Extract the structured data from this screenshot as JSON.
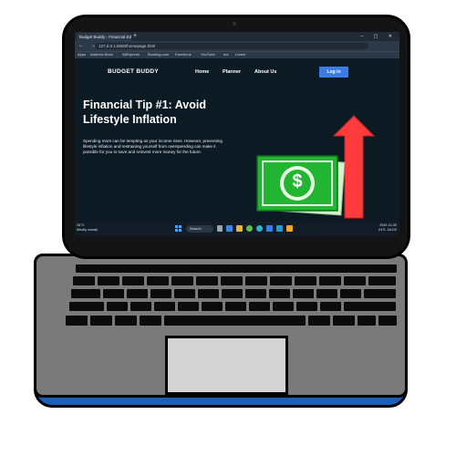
{
  "browser": {
    "tab_title": "Budget Buddy - Financial Educa...",
    "tab_new": "+",
    "window_controls": "– ▢ ✕",
    "nav_icons": "← → ⟳",
    "url": "127.0.0.1:5500/homepage.html",
    "bookmarks": [
      {
        "label": "Apps",
        "icon": "apps-icon"
      },
      {
        "label": "Address Book",
        "icon": "bookmark-icon"
      },
      {
        "label": "AliExpress",
        "icon": "bookmark-icon"
      },
      {
        "label": "Booking.com",
        "icon": "bookmark-icon"
      },
      {
        "label": "Facebook",
        "icon": "bookmark-icon"
      },
      {
        "label": "YouTube",
        "icon": "youtube-icon"
      },
      {
        "label": "eur",
        "icon": "bookmark-icon"
      },
      {
        "label": "Lorem",
        "icon": "folder-icon"
      }
    ]
  },
  "site": {
    "brand": "BUDGET BUDDY",
    "nav": [
      "Home",
      "Planner",
      "About Us"
    ],
    "login": "Log in",
    "headline": "Financial Tip #1: Avoid Lifestyle Inflation",
    "paragraph": "Spending more can be tempting as your income rises. However, preventing lifestyle inflation and restraining yourself from overspending can make it possible for you to save and reinvest more money for the future.",
    "hero_image": "money-arrow-up-icon",
    "currency_symbol": "$"
  },
  "taskbar": {
    "weather_temp": "26°C",
    "weather_desc": "Mostly cloudy",
    "search": "Search",
    "language": "ENG",
    "region": "INTL",
    "time": "11:30",
    "date": "24/10/"
  },
  "colors": {
    "site_bg": "#0c1a24",
    "login_button": "#3d7be6",
    "money_green": "#21b532",
    "arrow_red": "#ff3b3b",
    "laptop_base": "#7a7a7a",
    "laptop_trim": "#1c5fb8"
  }
}
